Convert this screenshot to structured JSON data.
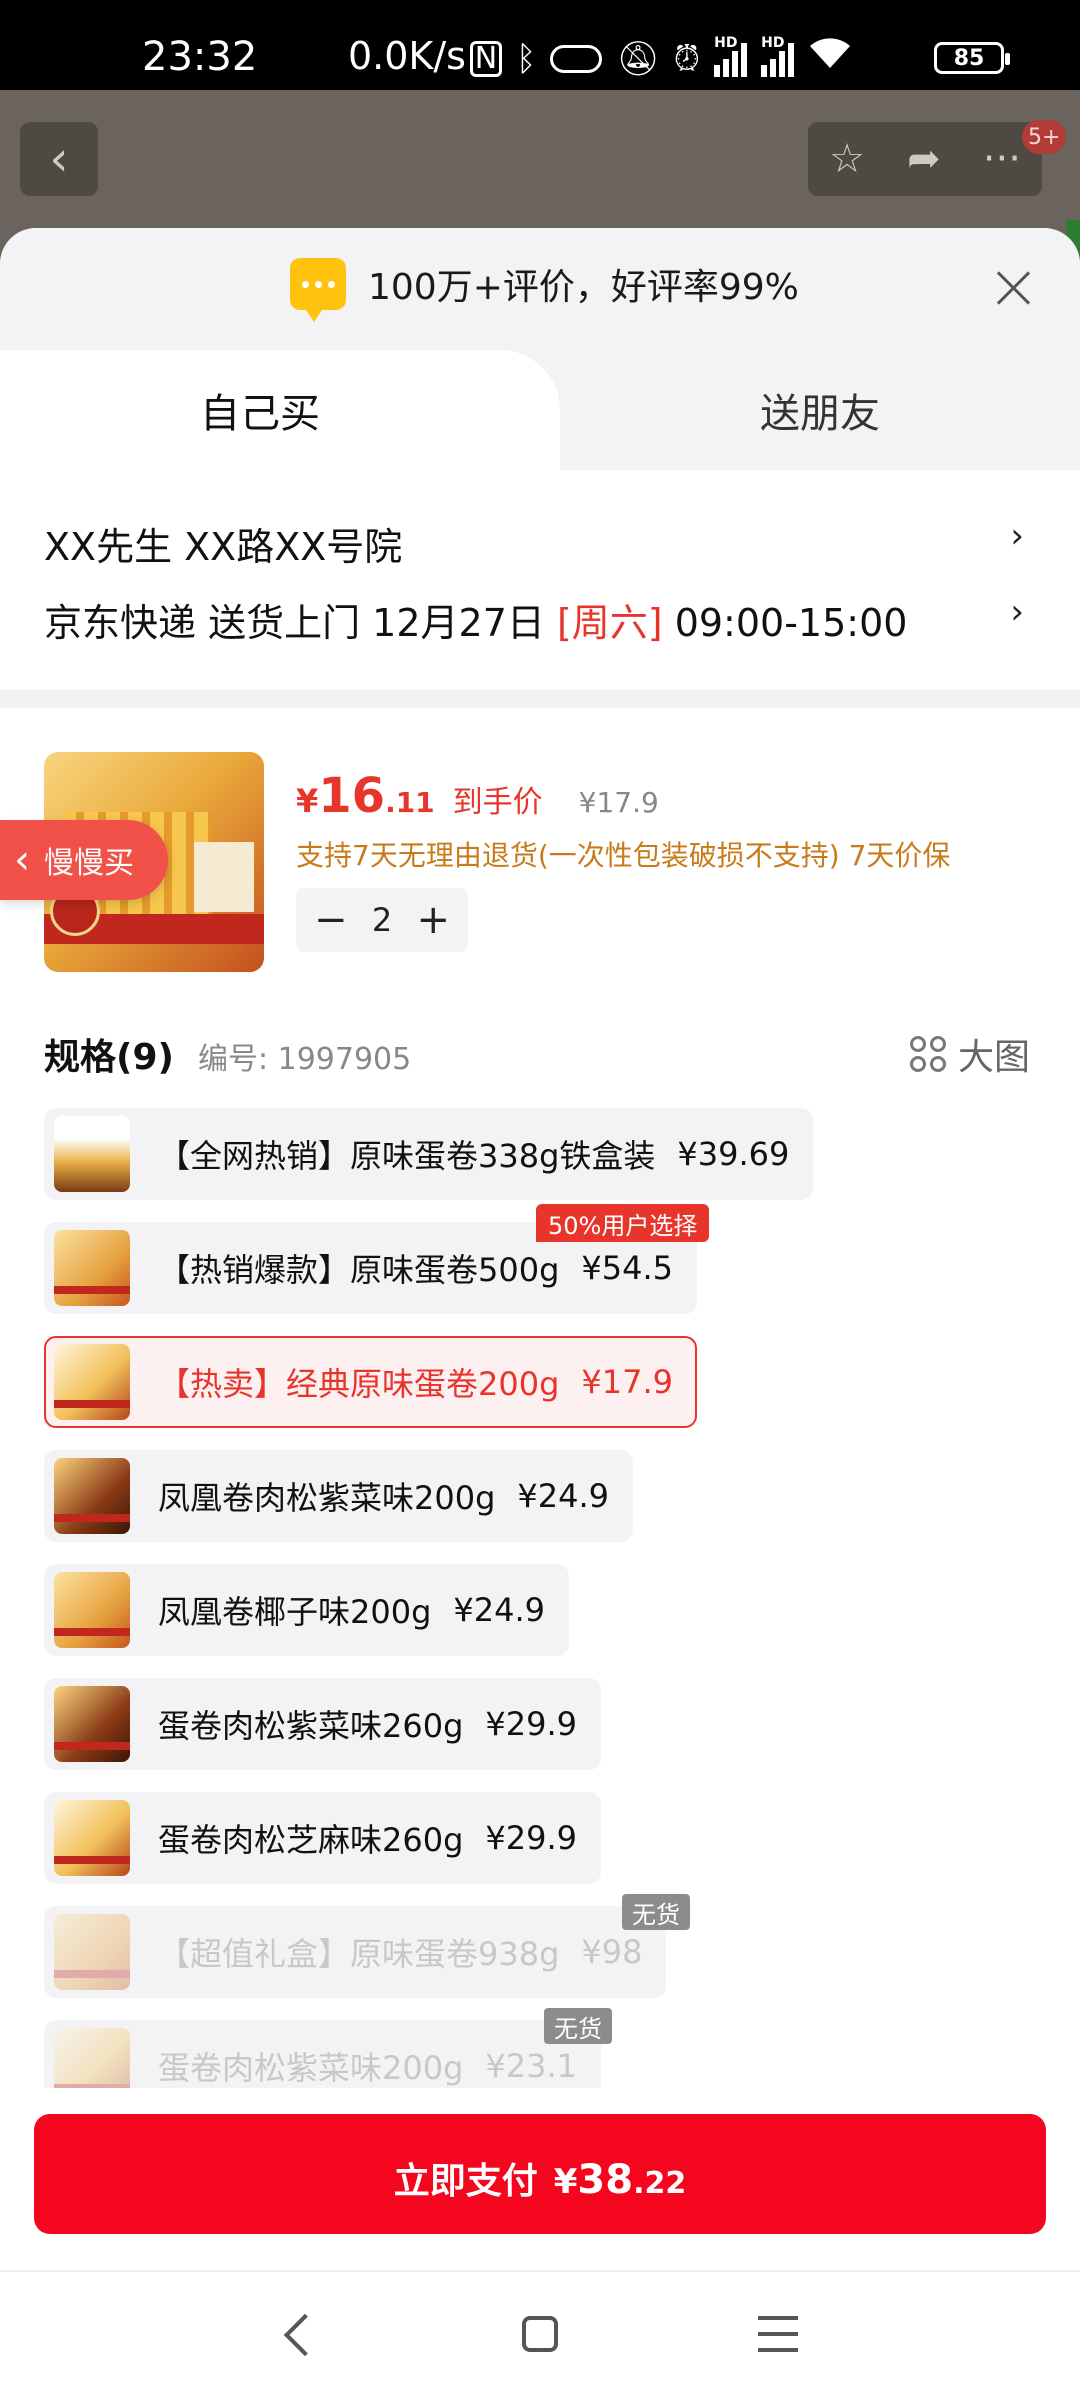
{
  "status_bar": {
    "time": "23:32",
    "net_speed": "0.0K/s",
    "battery": "85",
    "hd_label": "HD"
  },
  "header": {
    "back_icon": "back-arrow-icon",
    "badge": "5+"
  },
  "sheet": {
    "review_text": "100万+评价，好评率99%",
    "tabs": [
      {
        "label": "自己买",
        "active": true
      },
      {
        "label": "送朋友",
        "active": false
      }
    ],
    "address": {
      "line1": "XX先生  XX路XX号院",
      "delivery_prefix": "京东快递 送货上门 12月27日 ",
      "delivery_day": "[周六]",
      "delivery_time": " 09:00-15:00"
    },
    "product": {
      "slow_buy_label": "慢慢买",
      "price_symbol": "¥",
      "price_int": "16",
      "price_dec": ".11",
      "price_tag": "到手价",
      "original_price": "¥17.9",
      "promise": "支持7天无理由退货(一次性包装破损不支持) 7天价保",
      "quantity": "2",
      "minus": "−",
      "plus": "+"
    },
    "spec_header": {
      "title": "规格(9)",
      "code": "编号: 1997905",
      "big_picture": "大图"
    },
    "specs": [
      {
        "name": "【全网热销】原味蛋卷338g铁盒装",
        "price": "¥39.69"
      },
      {
        "name": "【热销爆款】原味蛋卷500g",
        "price": "¥54.5",
        "badge": "50%用户选择"
      },
      {
        "name": "【热卖】经典原味蛋卷200g",
        "price": "¥17.9",
        "selected": true
      },
      {
        "name": "凤凰卷肉松紫菜味200g",
        "price": "¥24.9"
      },
      {
        "name": "凤凰卷椰子味200g",
        "price": "¥24.9"
      },
      {
        "name": "蛋卷肉松紫菜味260g",
        "price": "¥29.9"
      },
      {
        "name": "蛋卷肉松芝麻味260g",
        "price": "¥29.9"
      },
      {
        "name": "【超值礼盒】原味蛋卷938g",
        "price": "¥98",
        "badge": "无货",
        "disabled": true
      },
      {
        "name": "蛋卷肉松紫菜味200g",
        "price": "¥23.1",
        "badge": "无货",
        "disabled": true
      }
    ]
  },
  "pay_button": {
    "label": "立即支付",
    "symbol": "¥",
    "int": "38",
    "dec": ".22"
  },
  "colors": {
    "accent_red": "#e8352b",
    "pay_red": "#f4061f",
    "promise_orange": "#c97b1b"
  }
}
